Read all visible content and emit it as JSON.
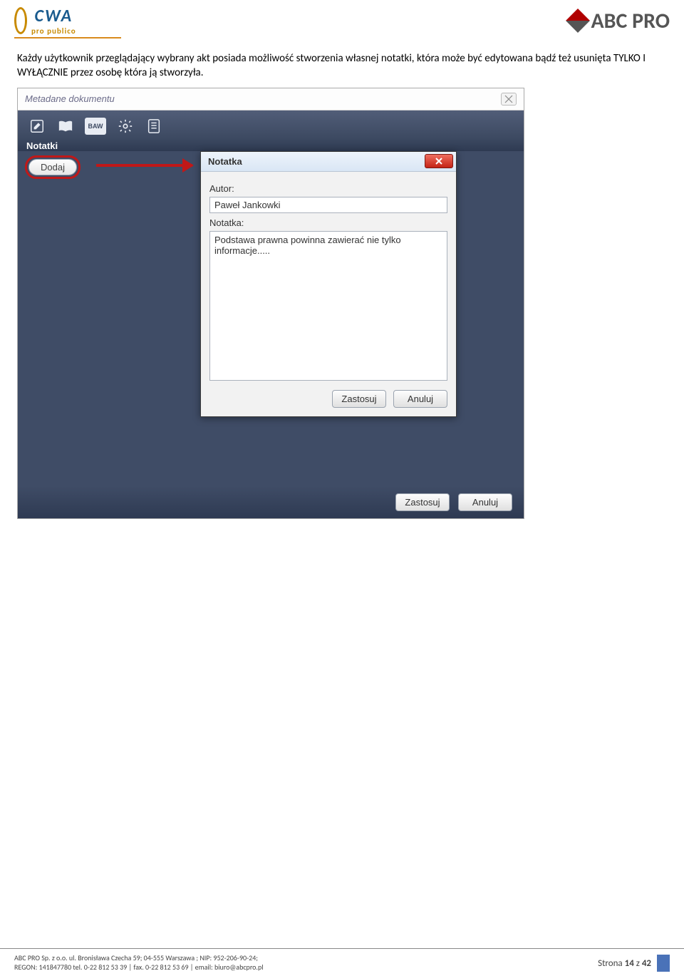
{
  "header": {
    "logo_left_top": "CWA",
    "logo_left_bottom": "pro publico",
    "logo_right": "ABC PRO"
  },
  "body": {
    "paragraph": "Każdy użytkownik przeglądający wybrany akt posiada możliwość stworzenia własnej notatki, która może być edytowana bądź też usunięta TYLKO I WYŁĄCZNIE przez osobę która ją stworzyła."
  },
  "screenshot": {
    "window_title": "Metadane dokumentu",
    "toolbar_icons": {
      "edit": "edit-icon",
      "book": "book-icon",
      "baw": "BAW",
      "gear": "gear-icon",
      "list": "list-icon"
    },
    "tab_label": "Notatki",
    "left_pill": "Dodaj",
    "inner": {
      "title": "Notatka",
      "author_label": "Autor:",
      "author_value": "Paweł Jankowki",
      "note_label": "Notatka:",
      "note_value": "Podstawa prawna powinna zawierać nie tylko informacje.....",
      "apply": "Zastosuj",
      "cancel": "Anuluj"
    },
    "outer_buttons": {
      "apply": "Zastosuj",
      "cancel": "Anuluj"
    }
  },
  "footer": {
    "line1": "ABC PRO Sp. z o.o. ul. Bronisława Czecha 59;  04-555 Warszawa ; NIP: 952-206-90-24;",
    "line2": "REGON: 141847780 tel. 0-22 812 53 39 | fax. 0-22 812 53 69 | email: biuro@abcpro.pl",
    "page_label_pre": "Strona ",
    "page_current": "14",
    "page_sep": " z ",
    "page_total": "42"
  }
}
